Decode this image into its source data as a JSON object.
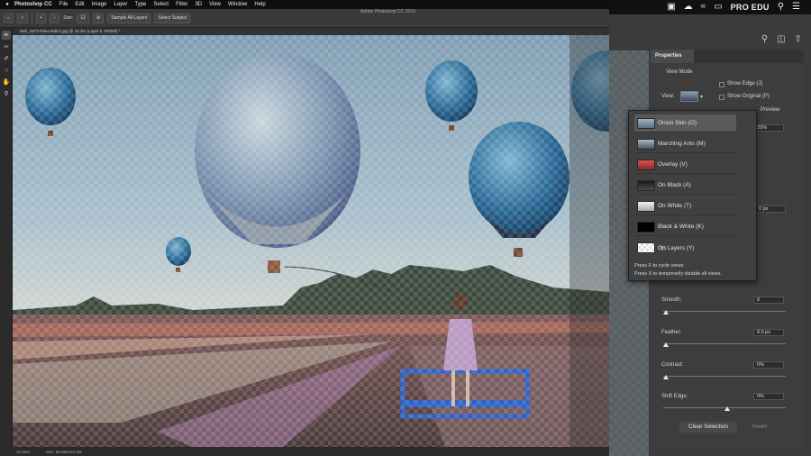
{
  "menubar": {
    "apple": "",
    "app_name": "Photoshop CC",
    "items": [
      "File",
      "Edit",
      "Image",
      "Layer",
      "Type",
      "Select",
      "Filter",
      "3D",
      "View",
      "Window",
      "Help"
    ]
  },
  "statusbar": {
    "brand": "PRO EDU",
    "icons": [
      "camera-icon",
      "cloud-icon",
      "wifi-icon",
      "airplay-icon",
      "search-icon",
      "list-icon"
    ]
  },
  "options": {
    "window_title": "Adobe Photoshop CC 2019",
    "size_label": "Size:",
    "size_value": "12",
    "sample_all_layers": "Sample All Layers",
    "select_subject": "Select Subject"
  },
  "document": {
    "tab_title": "IMG_5873-Pano-Edit-2.jpg @ 33.3% (Layer 0, RGB/8) *"
  },
  "bottom": {
    "zoom": "33.33%",
    "doc_info": "Doc: 96.0M/194.4M"
  },
  "properties": {
    "tab_label": "Properties",
    "view_mode_label": "View Mode",
    "view_label": "View:",
    "show_edge": "Show Edge (J)",
    "show_original": "Show Original (P)",
    "preview_label": "Preview",
    "opacity_value": "20%",
    "radius_value": "0 px",
    "smooth_label": "Smooth:",
    "smooth_value": "0",
    "feather_label": "Feather:",
    "feather_value": "0.0 px",
    "contrast_label": "Contrast:",
    "contrast_value": "0%",
    "shift_edge_label": "Shift Edge:",
    "shift_edge_value": "0%",
    "clear_selection": "Clear Selection",
    "invert": "Invert"
  },
  "view_menu": {
    "items": [
      {
        "label": "Onion Skin (O)",
        "thumb": "onion"
      },
      {
        "label": "Marching Ants (M)",
        "thumb": "ants"
      },
      {
        "label": "Overlay (V)",
        "thumb": "overlay"
      },
      {
        "label": "On Black (A)",
        "thumb": "black"
      },
      {
        "label": "On White (T)",
        "thumb": "white"
      },
      {
        "label": "Black & White (K)",
        "thumb": "bw"
      },
      {
        "label": "On Layers (Y)",
        "thumb": "layers"
      }
    ],
    "selected_index": 0,
    "hint_1": "Press F to cycle views.",
    "hint_2": "Press X to temporarily disable all views."
  },
  "colors": {
    "panel_bg": "#3d3d3d",
    "menu_bg": "#404040",
    "sky_top": "#7f9db3",
    "balloon_blue": "#2a6c9c"
  }
}
